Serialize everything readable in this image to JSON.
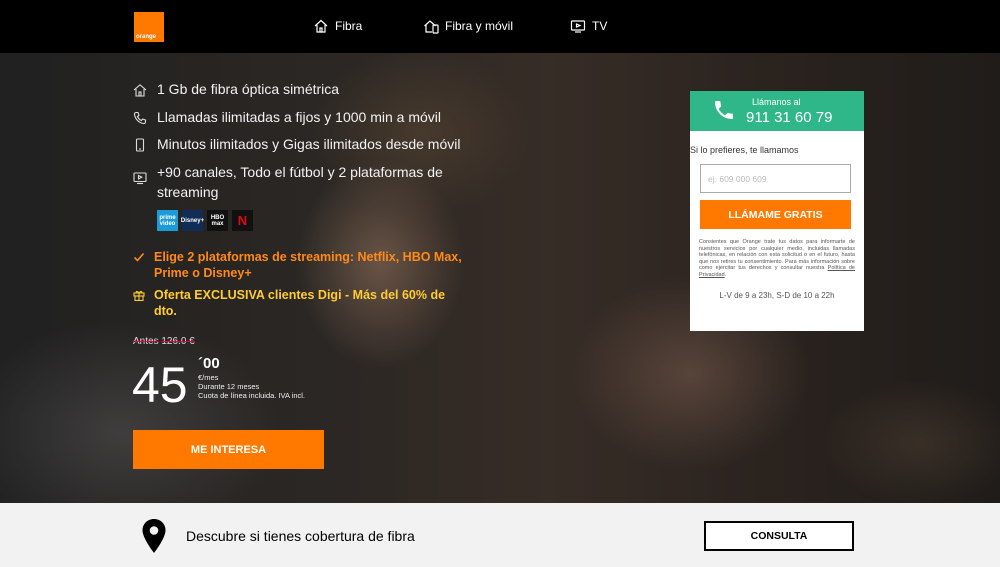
{
  "header": {
    "logo_text": "orange",
    "nav": [
      {
        "label": "Fibra",
        "icon": "home-icon"
      },
      {
        "label": "Fibra y móvil",
        "icon": "home-mobile-icon"
      },
      {
        "label": "TV",
        "icon": "tv-icon"
      }
    ]
  },
  "hero": {
    "features": [
      {
        "text": "1 Gb de fibra óptica simétrica",
        "icon": "home-icon"
      },
      {
        "text": "Llamadas ilimitadas a fijos y 1000 min a móvil",
        "icon": "phone-icon"
      },
      {
        "text": "Minutos ilimitados y Gigas ilimitados desde móvil",
        "icon": "mobile-icon"
      },
      {
        "text": "+90 canales, Todo el fútbol y 2 plataformas de streaming",
        "icon": "tv-icon"
      }
    ],
    "platforms": [
      {
        "name": "prime video"
      },
      {
        "name": "Disney+"
      },
      {
        "name": "HBO max"
      },
      {
        "name": "N"
      }
    ],
    "promo_streaming": "Elige 2 plataformas de streaming: Netflix, HBO Max, Prime o Disney+",
    "promo_digi": "Oferta EXCLUSIVA clientes Digi - Más del 60% de dto.",
    "price": {
      "before_label": "Antes",
      "before_value": "126.0 €",
      "amount": "45",
      "decimals": "´00",
      "unit": "€/mes",
      "duration": "Durante 12 meses",
      "note": "Cuota de línea incluida. IVA incl."
    },
    "cta_label": "ME INTERESA"
  },
  "callbox": {
    "label": "Llámanos al",
    "number": "911 31 60 79",
    "subtitle": "Si lo prefieres, te llamamos",
    "input_placeholder": "ej: 609 000 609",
    "button_label": "LLÁMAME GRATIS",
    "consent_text": "Consientes que Orange trate tus datos para informarte de nuestros servicios por cualquier medio, incluidas llamadas telefónicas, en relación con esta solicitud o en el futuro, hasta que nos retires tu consentimiento. Para más información sobre como ejercitar tus derechos y consultar nuestra ",
    "privacy_link": "Política de Privacidad",
    "hours": "L-V de 9 a 23h, S-D de 10 a 22h"
  },
  "coverage": {
    "text": "Descubre si tienes cobertura de fibra",
    "button_label": "CONSULTA"
  },
  "colors": {
    "brand_orange": "#ff7900",
    "call_green": "#2fb78a",
    "promo_yellow": "#ffcc33"
  }
}
